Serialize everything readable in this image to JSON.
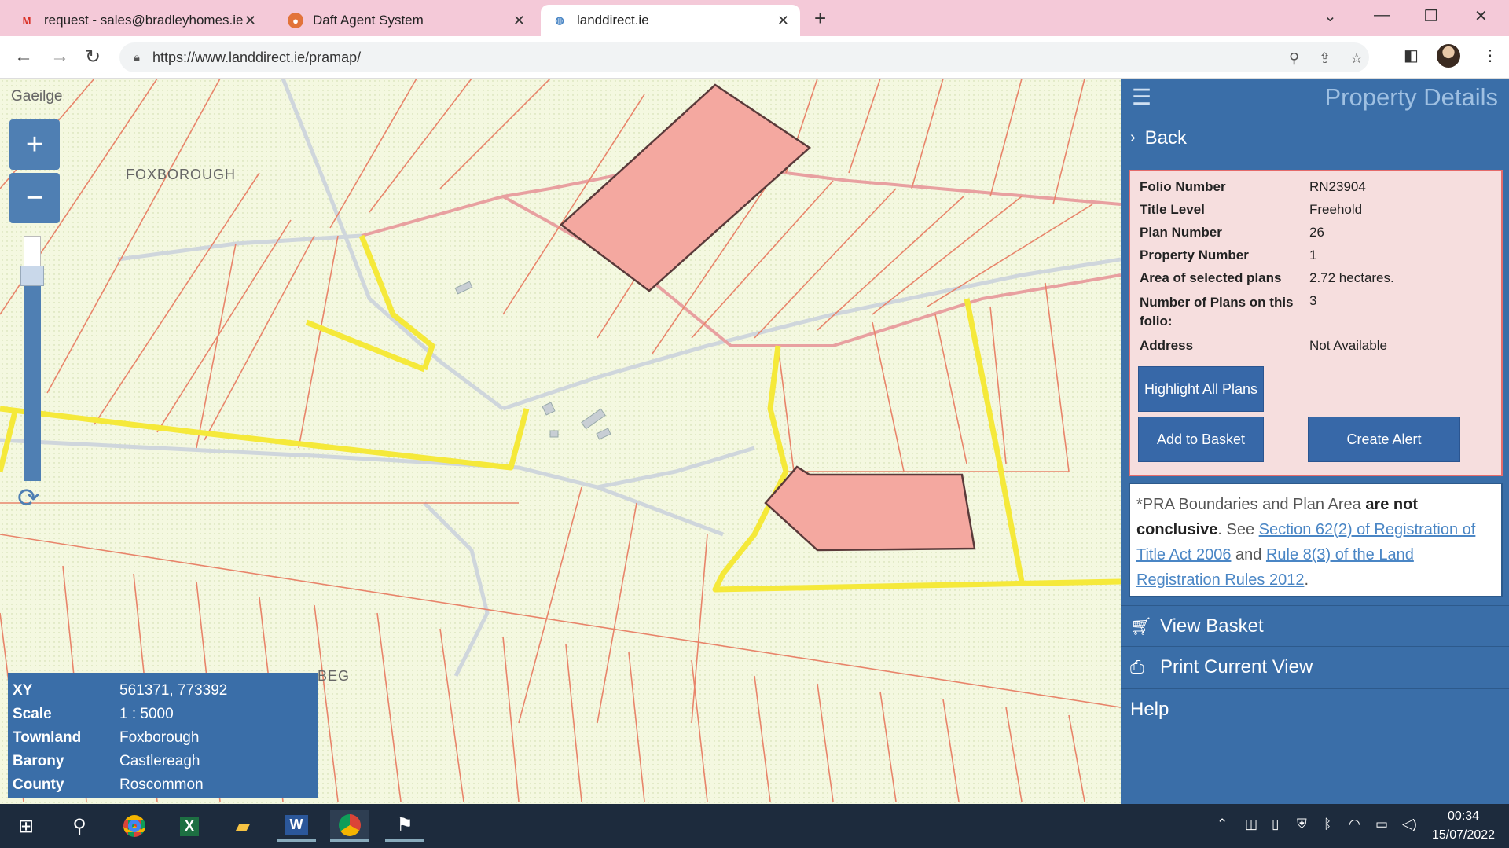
{
  "browser": {
    "tabs": [
      {
        "title": "request - sales@bradleyhomes.ie",
        "icon": "gmail-icon"
      },
      {
        "title": "Daft Agent System",
        "icon": "daft-icon"
      },
      {
        "title": "landdirect.ie",
        "icon": "globe-icon"
      }
    ],
    "url": "https://www.landdirect.ie/pramap/"
  },
  "map": {
    "language_link": "Gaeilge",
    "zoom_in": "+",
    "zoom_out": "−",
    "labels": [
      "FOXBOROUGH",
      "BEG"
    ],
    "info": [
      {
        "key": "XY",
        "value": "561371, 773392"
      },
      {
        "key": "Scale",
        "value": "1 : 5000"
      },
      {
        "key": "Townland",
        "value": "Foxborough"
      },
      {
        "key": "Barony",
        "value": "Castlereagh"
      },
      {
        "key": "County",
        "value": "Roscommon"
      }
    ]
  },
  "panel": {
    "title": "Property Details",
    "back": "Back",
    "details": [
      {
        "key": "Folio Number",
        "value": "RN23904"
      },
      {
        "key": "Title Level",
        "value": "Freehold"
      },
      {
        "key": "Plan Number",
        "value": "26"
      },
      {
        "key": "Property Number",
        "value": "1"
      },
      {
        "key": "Area of selected plans",
        "value": "2.72 hectares."
      },
      {
        "key": "Number of Plans on this folio:",
        "value": "3"
      },
      {
        "key": "Address",
        "value": "Not Available"
      }
    ],
    "highlight_button": "Highlight All Plans",
    "basket_button": "Add to Basket",
    "alert_button": "Create Alert",
    "notice": {
      "part1": "*PRA Boundaries and Plan Area ",
      "bold": "are not conclusive",
      "part2": ". See ",
      "link1": "Section 62(2) of Registration of Title Act 2006",
      "part3": " and ",
      "link2": "Rule 8(3) of the Land Registration Rules 2012",
      "part4": "."
    },
    "menu": {
      "view_basket": "View Basket",
      "print": "Print Current View",
      "help": "Help"
    }
  },
  "taskbar": {
    "time": "00:34",
    "date": "15/07/2022"
  },
  "colors": {
    "panel_blue": "#3a6ea8",
    "parcel_fill": "#f4a8a0",
    "boundary_yellow": "#f5e93a",
    "parcel_line": "#e8846a"
  }
}
